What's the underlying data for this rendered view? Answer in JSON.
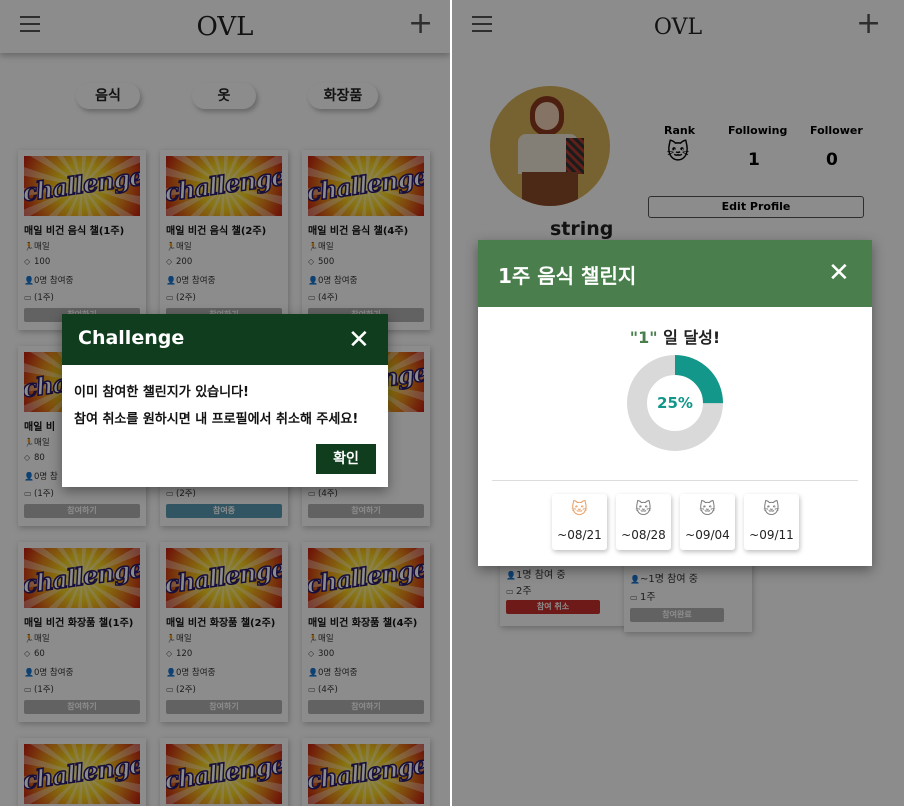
{
  "left": {
    "app_title": "OVL",
    "categories": [
      "음식",
      "옷",
      "화장품"
    ],
    "image_text": "challenge",
    "cards": [
      {
        "title": "매일 비건 음식 챌(1주)",
        "freq": "매일",
        "points": "100",
        "participants": "0명 참여중",
        "period": "(1주)",
        "button": "참여하기"
      },
      {
        "title": "매일 비건 음식 챌(2주)",
        "freq": "매일",
        "points": "200",
        "participants": "0명 참여중",
        "period": "(2주)",
        "button": "참여하기"
      },
      {
        "title": "매일 비건 음식 챌(4주)",
        "freq": "매일",
        "points": "500",
        "participants": "0명 참여중",
        "period": "(4주)",
        "button": "참여하기"
      },
      {
        "title": "매일 비",
        "freq": "매일",
        "points": "80",
        "participants": "0명 참",
        "period": "(1주)",
        "button": "참여하기"
      },
      {
        "title": "",
        "freq": "",
        "points": "",
        "participants": "",
        "period": "(2주)",
        "button": "참여중"
      },
      {
        "title": "주)",
        "freq": "",
        "points": "",
        "participants": "",
        "period": "(4주)",
        "button": "참여하기"
      },
      {
        "title": "매일 비건 화장품 챌(1주)",
        "freq": "매일",
        "points": "60",
        "participants": "0명 참여중",
        "period": "(1주)",
        "button": "참여하기"
      },
      {
        "title": "매일 비건 화장품 챌(2주)",
        "freq": "매일",
        "points": "120",
        "participants": "0명 참여중",
        "period": "(2주)",
        "button": "참여하기"
      },
      {
        "title": "매일 비건 화장품 챌(4주)",
        "freq": "매일",
        "points": "300",
        "participants": "0명 참여중",
        "period": "(4주)",
        "button": "참여하기"
      }
    ],
    "modal": {
      "title": "Challenge",
      "line1": "이미 참여한 챌린지가 있습니다!",
      "line2": "참여 취소를 원하시면 내 프로필에서 취소해 주세요!",
      "confirm": "확인"
    }
  },
  "right": {
    "app_title": "OVL",
    "username": "string",
    "stats": {
      "rank_label": "Rank",
      "following_label": "Following",
      "following": "1",
      "follower_label": "Follower",
      "follower": "0"
    },
    "edit_profile": "Edit Profile",
    "bg_cards": [
      {
        "participants": "1명 참여 중",
        "period": "2주",
        "button": "참여 취소"
      },
      {
        "participants": "~1명 참여 중",
        "period": "1주",
        "button": "참여완료"
      }
    ],
    "modal": {
      "title": "1주 음식 챌린지",
      "achieved_value": "\"1\"",
      "achieved_suffix": " 일 달성!",
      "progress": 25,
      "progress_label": "25%",
      "weeks": [
        "~08/21",
        "~08/28",
        "~09/04",
        "~09/11"
      ]
    }
  },
  "colors": {
    "dark_green": "#0f3d1e",
    "header_green": "#4a7f4d",
    "teal": "#12978a",
    "gray_ring": "#d9d9d9",
    "active_blue": "#5a9bb5",
    "cancel_red": "#c9302c"
  }
}
